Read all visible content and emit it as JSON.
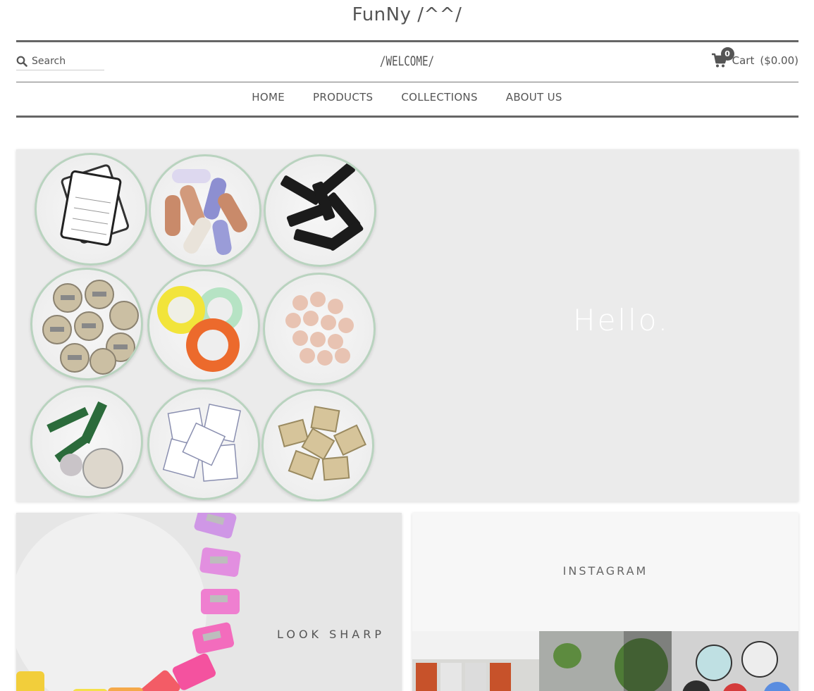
{
  "site": {
    "title": "FunNy /^^/"
  },
  "header": {
    "search_placeholder": "Search",
    "welcome": "/WELCOME/",
    "cart_count": "0",
    "cart_label": "Cart",
    "cart_total": "($0.00)"
  },
  "nav": {
    "items": [
      "HOME",
      "PRODUCTS",
      "COLLECTIONS",
      "ABOUT US"
    ]
  },
  "hero": {
    "text": "Hello."
  },
  "cards": {
    "left": {
      "label": "LOOK SHARP"
    },
    "right": {
      "label": "INSTAGRAM"
    }
  },
  "colors": {
    "text": "#555555",
    "rule": "#666666",
    "hero_bg": "#ebebeb",
    "bowl_rim": "#b9d3bf"
  },
  "icons": {
    "search": "search-icon",
    "cart": "cart-icon"
  }
}
